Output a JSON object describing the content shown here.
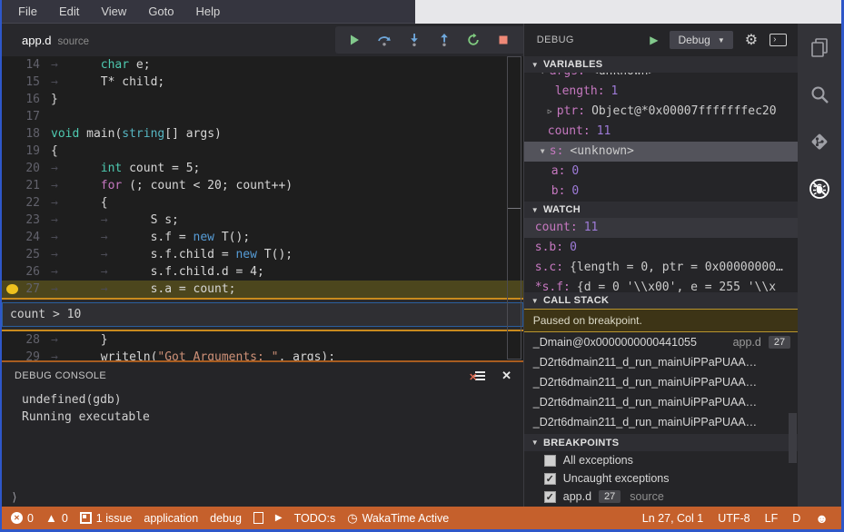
{
  "colors": {
    "window_border": "#2e57c9",
    "status_bar": "#c5602c",
    "breakpoint": "#eec11e",
    "current_line": "#4c461d",
    "condition_border": "#c98a1e",
    "paused_border": "#b9952e",
    "keyword_teal": "#4ec9b0",
    "keyword_magenta": "#c678c0",
    "keyword_blue": "#569cd6",
    "string_orange": "#ce9178",
    "var_name": "#c678c0",
    "var_number": "#9e7bd8"
  },
  "menu": {
    "items": [
      "File",
      "Edit",
      "View",
      "Goto",
      "Help"
    ]
  },
  "tab": {
    "title": "app.d",
    "subtitle": "source"
  },
  "toolbar": {
    "buttons": [
      {
        "name": "continue-button",
        "icon": "play"
      },
      {
        "name": "step-over-button",
        "icon": "step-over"
      },
      {
        "name": "step-into-button",
        "icon": "step-into"
      },
      {
        "name": "step-out-button",
        "icon": "step-out"
      },
      {
        "name": "restart-button",
        "icon": "restart"
      },
      {
        "name": "stop-button",
        "icon": "stop"
      }
    ]
  },
  "editor": {
    "condition": "count > 10",
    "lines": [
      {
        "n": "14",
        "ind": 1,
        "tokens": [
          [
            "kw",
            "char"
          ],
          [
            "pl",
            " e;"
          ]
        ]
      },
      {
        "n": "15",
        "ind": 1,
        "tokens": [
          [
            "pl",
            "T* child;"
          ]
        ]
      },
      {
        "n": "16",
        "ind": 0,
        "tokens": [
          [
            "pl",
            "}"
          ]
        ]
      },
      {
        "n": "17",
        "ind": 0,
        "tokens": []
      },
      {
        "n": "18",
        "ind": 0,
        "tokens": [
          [
            "kw",
            "void"
          ],
          [
            "pl",
            " main("
          ],
          [
            "ty",
            "string"
          ],
          [
            "pl",
            "[] args)"
          ]
        ]
      },
      {
        "n": "19",
        "ind": 0,
        "tokens": [
          [
            "pl",
            "{"
          ]
        ]
      },
      {
        "n": "20",
        "ind": 1,
        "tokens": [
          [
            "kw",
            "int"
          ],
          [
            "pl",
            " count = 5;"
          ]
        ]
      },
      {
        "n": "21",
        "ind": 1,
        "tokens": [
          [
            "ctl",
            "for"
          ],
          [
            "pl",
            " (; count < 20; count++)"
          ]
        ]
      },
      {
        "n": "22",
        "ind": 1,
        "tokens": [
          [
            "pl",
            "{"
          ]
        ]
      },
      {
        "n": "23",
        "ind": 2,
        "tokens": [
          [
            "pl",
            "S s;"
          ]
        ]
      },
      {
        "n": "24",
        "ind": 2,
        "tokens": [
          [
            "pl",
            "s.f = "
          ],
          [
            "nw",
            "new"
          ],
          [
            "pl",
            " T();"
          ]
        ]
      },
      {
        "n": "25",
        "ind": 2,
        "tokens": [
          [
            "pl",
            "s.f.child = "
          ],
          [
            "nw",
            "new"
          ],
          [
            "pl",
            " T();"
          ]
        ]
      },
      {
        "n": "26",
        "ind": 2,
        "tokens": [
          [
            "pl",
            "s.f.child.d = 4;"
          ]
        ]
      },
      {
        "n": "27",
        "ind": 2,
        "current": true,
        "bp": true,
        "widget_after": true,
        "tokens": [
          [
            "pl",
            "s.a = count;"
          ]
        ]
      },
      {
        "n": "28",
        "ind": 1,
        "tokens": [
          [
            "pl",
            "}"
          ]
        ]
      },
      {
        "n": "29",
        "ind": 1,
        "tokens": [
          [
            "pl",
            "writeln("
          ],
          [
            "str",
            "\"Got Arguments: \""
          ],
          [
            "pl",
            ", args);"
          ]
        ]
      }
    ]
  },
  "console": {
    "title": "DEBUG CONSOLE",
    "lines": [
      "undefined(gdb)",
      "Running executable"
    ],
    "prompt": "⟩"
  },
  "debug_panel": {
    "title": "DEBUG",
    "config_label": "Debug",
    "sections": {
      "variables": {
        "label": "VARIABLES",
        "rows": [
          {
            "pad": 18,
            "twisty": "exp",
            "name": "args:",
            "value": "<unknown>",
            "vt": "pl",
            "clip": true
          },
          {
            "pad": 34,
            "name": "length:",
            "value": "1",
            "vt": "num"
          },
          {
            "pad": 26,
            "twisty": "col",
            "name": "ptr:",
            "value": "Object@*0x00007fffffffec20",
            "vt": "pl"
          },
          {
            "pad": 26,
            "name": "count:",
            "value": "11",
            "vt": "num"
          },
          {
            "pad": 18,
            "twisty": "exp",
            "name": "s:",
            "value": "<unknown>",
            "vt": "pl",
            "selected": true
          },
          {
            "pad": 30,
            "name": "a:",
            "value": "0",
            "vt": "num"
          },
          {
            "pad": 30,
            "name": "b:",
            "value": "0",
            "vt": "num"
          }
        ]
      },
      "watch": {
        "label": "WATCH",
        "rows": [
          {
            "name": "count:",
            "value": "11",
            "vt": "num",
            "selected": true
          },
          {
            "name": "s.b:",
            "value": "0",
            "vt": "num"
          },
          {
            "name": "s.c:",
            "value": "{length = 0, ptr = 0x00000000…",
            "vt": "pl"
          },
          {
            "name": "*s.f:",
            "value": "{d = 0 '\\\\x00', e = 255 '\\\\x",
            "vt": "pl"
          }
        ]
      },
      "call_stack": {
        "label": "CALL STACK",
        "status": "Paused on breakpoint.",
        "frames": [
          {
            "name": "_Dmain@0x0000000000441055",
            "file": "app.d",
            "line": "27"
          },
          {
            "name": "_D2rt6dmain211_d_run_mainUiPPaPUAA…"
          },
          {
            "name": "_D2rt6dmain211_d_run_mainUiPPaPUAA…"
          },
          {
            "name": "_D2rt6dmain211_d_run_mainUiPPaPUAA…"
          },
          {
            "name": "_D2rt6dmain211_d_run_mainUiPPaPUAA…"
          }
        ]
      },
      "breakpoints": {
        "label": "BREAKPOINTS",
        "items": [
          {
            "checked": false,
            "label": "All exceptions"
          },
          {
            "checked": true,
            "label": "Uncaught exceptions"
          },
          {
            "checked": true,
            "label": "app.d",
            "line": "27",
            "desc": "source"
          }
        ]
      }
    }
  },
  "activity_bar": {
    "icons": [
      {
        "name": "files-icon",
        "active": false
      },
      {
        "name": "search-icon",
        "active": false
      },
      {
        "name": "git-icon",
        "active": false
      },
      {
        "name": "debug-icon",
        "active": true
      }
    ]
  },
  "status_bar": {
    "errors": "0",
    "warnings": "0",
    "issues": "1 issue",
    "application": "application",
    "debug": "debug",
    "todo": "TODO:s",
    "wakatime": "WakaTime Active",
    "line_col": "Ln 27, Col 1",
    "encoding": "UTF-8",
    "eol": "LF",
    "language": "D"
  }
}
